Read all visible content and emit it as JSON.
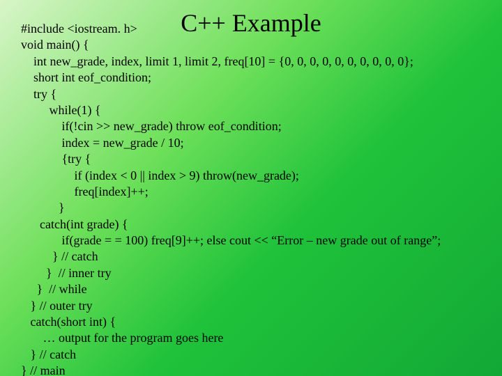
{
  "title": "C++ Example",
  "code_lines": [
    "#include <iostream. h>",
    "void main() {",
    "    int new_grade, index, limit 1, limit 2, freq[10] = {0, 0, 0, 0, 0, 0, 0, 0, 0, 0};",
    "    short int eof_condition;",
    "    try {",
    "         while(1) {",
    "             if(!cin >> new_grade) throw eof_condition;",
    "             index = new_grade / 10;",
    "             {try {",
    "                 if (index < 0 || index > 9) throw(new_grade);",
    "                 freq[index]++;",
    "            }",
    "      catch(int grade) {",
    "             if(grade = = 100) freq[9]++; else cout << “Error – new grade out of range”;",
    "          } // catch",
    "        }  // inner try",
    "     }  // while",
    "   } // outer try",
    "   catch(short int) {",
    "       … output for the program goes here",
    "   } // catch",
    "} // main"
  ]
}
